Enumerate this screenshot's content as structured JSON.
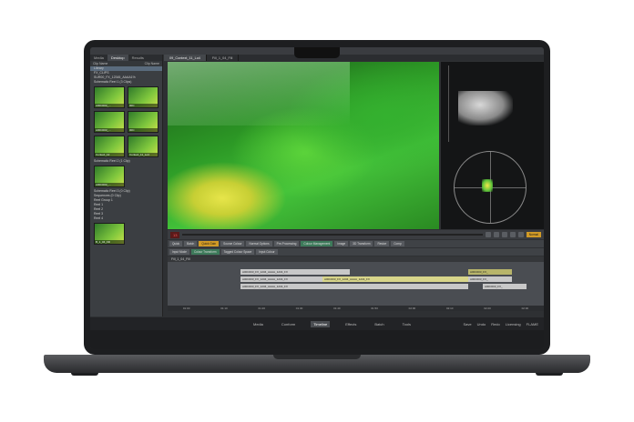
{
  "app": {
    "panel_tabs": [
      "Media",
      "Desktop",
      "Results",
      "Grid"
    ],
    "panel_header_left": "Clip Name",
    "panel_header_right": "Clip Name",
    "viewer_tabs": [
      "09_Context_11_Lo4",
      "Fill_1_04_Fill"
    ],
    "tree": [
      "Library",
      "FX_CLIPS",
      "SUR00_FX_12345_AAAA1%",
      "Schematic Reel 1 (3 Clips)",
      "Schematic Reel 2 (1 Clip)",
      "Schematic Reel 3 (0 Clip)",
      "Sequences (0 Clip)",
      "Reel Group 1",
      "Reel 1",
      "Reel 2",
      "Reel 3",
      "Reel 4"
    ],
    "thumbnails": [
      "A00C003_...",
      "00C",
      "A00C003_...",
      "00C",
      "Context_12",
      "Context_11_Lo4",
      "A00C003_...",
      "B_1_04_Fill"
    ],
    "timecode": "13",
    "transport_mode": "Normal",
    "fx_buttons_row1": [
      "Quick",
      "Batch",
      "Quick Gain",
      "Source Colour",
      "Normal Options",
      "Pre-Processing",
      "Colour Management",
      "Image",
      "3D Transform",
      "Resize",
      "Comp"
    ],
    "fx_buttons_row2": [
      "Input Mode",
      "Colour Transform",
      "Tagged Colour Space",
      "Input Colour"
    ],
    "timeline_header": "Fill_1_04_Fill",
    "clips": [
      "A00C003_FX_1234_AAAA_1234_FX",
      "A00C003_FX_1234_AAAA_1234_FX",
      "A00C003_FX_1234_AAAA_1234_FX",
      "A00C003_FX_",
      "A00C003_FX_",
      "A00C003_FX_"
    ],
    "ruler": [
      "01:00",
      "01:10",
      "01:20",
      "01:30",
      "01:40",
      "01:50",
      "02:00",
      "02:10",
      "02:20",
      "02:30"
    ],
    "bottom_nav": [
      "Media",
      "Conform",
      "Timeline",
      "Effects",
      "Batch",
      "Tools"
    ],
    "bottom_nav_active": "Timeline",
    "bottom_right": [
      "Save",
      "Undo",
      "Redo",
      "Licensing",
      "FLAME"
    ]
  },
  "colors": {
    "accent_orange": "#d19a26",
    "timecode_red": "#ff5a5a",
    "clip_yellow": "#d8d58a"
  }
}
